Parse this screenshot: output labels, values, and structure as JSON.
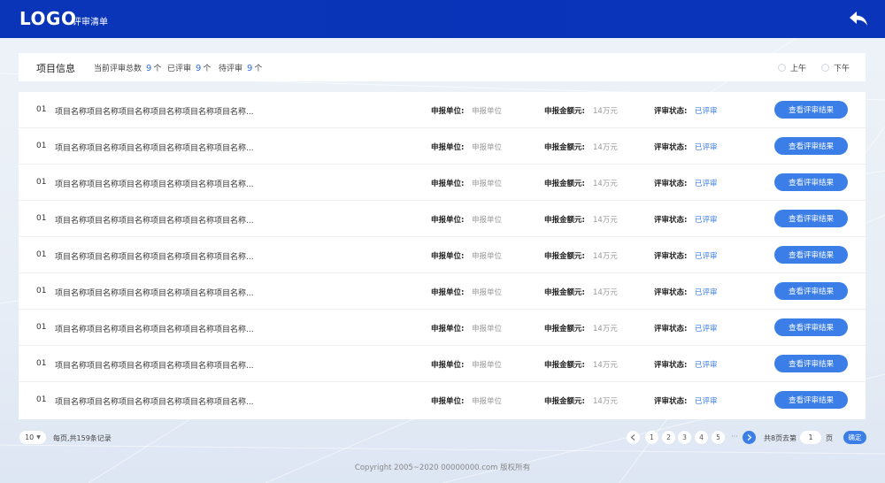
{
  "header": {
    "logo": "LOGO",
    "subtitle": "评审清单"
  },
  "info": {
    "title": "项目信息",
    "total_label": "当前评审总数",
    "total_value": "9",
    "reviewed_label": "已评审",
    "reviewed_value": "9",
    "pending_label": "待评审",
    "pending_value": "9",
    "unit": "个",
    "am_label": "上午",
    "pm_label": "下午"
  },
  "rows": [
    {
      "idx": "01",
      "name": "项目名称项目名称项目名称项目名称项目名称项目名称...",
      "unit_label": "申报单位:",
      "unit_value": "申报单位",
      "amount_label": "申报金额元:",
      "amount_value": "14万元",
      "status_label": "评审状态:",
      "status_value": "已评审",
      "button": "查看评审结果"
    },
    {
      "idx": "01",
      "name": "项目名称项目名称项目名称项目名称项目名称项目名称...",
      "unit_label": "申报单位:",
      "unit_value": "申报单位",
      "amount_label": "申报金额元:",
      "amount_value": "14万元",
      "status_label": "评审状态:",
      "status_value": "已评审",
      "button": "查看评审结果"
    },
    {
      "idx": "01",
      "name": "项目名称项目名称项目名称项目名称项目名称项目名称...",
      "unit_label": "申报单位:",
      "unit_value": "申报单位",
      "amount_label": "申报金额元:",
      "amount_value": "14万元",
      "status_label": "评审状态:",
      "status_value": "已评审",
      "button": "查看评审结果"
    },
    {
      "idx": "01",
      "name": "项目名称项目名称项目名称项目名称项目名称项目名称...",
      "unit_label": "申报单位:",
      "unit_value": "申报单位",
      "amount_label": "申报金额元:",
      "amount_value": "14万元",
      "status_label": "评审状态:",
      "status_value": "已评审",
      "button": "查看评审结果"
    },
    {
      "idx": "01",
      "name": "项目名称项目名称项目名称项目名称项目名称项目名称...",
      "unit_label": "申报单位:",
      "unit_value": "申报单位",
      "amount_label": "申报金额元:",
      "amount_value": "14万元",
      "status_label": "评审状态:",
      "status_value": "已评审",
      "button": "查看评审结果"
    },
    {
      "idx": "01",
      "name": "项目名称项目名称项目名称项目名称项目名称项目名称...",
      "unit_label": "申报单位:",
      "unit_value": "申报单位",
      "amount_label": "申报金额元:",
      "amount_value": "14万元",
      "status_label": "评审状态:",
      "status_value": "已评审",
      "button": "查看评审结果"
    },
    {
      "idx": "01",
      "name": "项目名称项目名称项目名称项目名称项目名称项目名称...",
      "unit_label": "申报单位:",
      "unit_value": "申报单位",
      "amount_label": "申报金额元:",
      "amount_value": "14万元",
      "status_label": "评审状态:",
      "status_value": "已评审",
      "button": "查看评审结果"
    },
    {
      "idx": "01",
      "name": "项目名称项目名称项目名称项目名称项目名称项目名称...",
      "unit_label": "申报单位:",
      "unit_value": "申报单位",
      "amount_label": "申报金额元:",
      "amount_value": "14万元",
      "status_label": "评审状态:",
      "status_value": "已评审",
      "button": "查看评审结果"
    },
    {
      "idx": "01",
      "name": "项目名称项目名称项目名称项目名称项目名称项目名称...",
      "unit_label": "申报单位:",
      "unit_value": "申报单位",
      "amount_label": "申报金额元:",
      "amount_value": "14万元",
      "status_label": "评审状态:",
      "status_value": "已评审",
      "button": "查看评审结果"
    }
  ],
  "pagination": {
    "page_size": "10",
    "summary": "每页,共159条记录",
    "prev_icon": "chevron-left-icon",
    "pages": [
      "1",
      "2",
      "3",
      "4",
      "5"
    ],
    "ellipsis": "···",
    "next_icon": "chevron-right-icon",
    "total_pages": "共8页",
    "goto_label": "去第",
    "goto_value": "1",
    "page_suffix": "页",
    "confirm": "确定"
  },
  "footer": {
    "copyright": "Copyright  2005~2020  00000000.com  版权所有"
  },
  "colors": {
    "header_bg": "#0a35b8",
    "accent": "#3b7ee8"
  }
}
